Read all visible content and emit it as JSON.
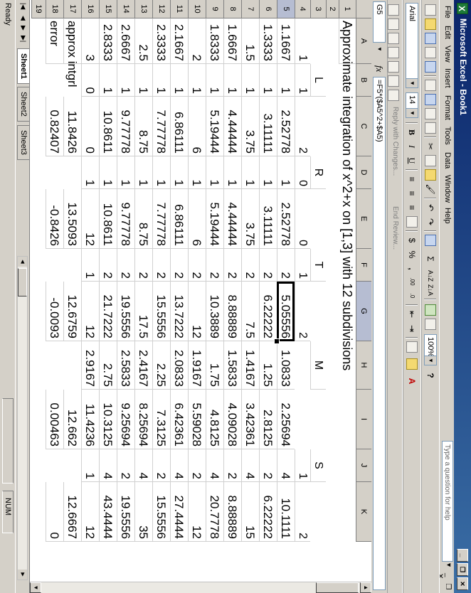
{
  "window": {
    "title": "Microsoft Excel - Book1",
    "app_icon_label": "X"
  },
  "menu": {
    "items": [
      "File",
      "Edit",
      "View",
      "Insert",
      "Format",
      "Tools",
      "Data",
      "Window",
      "Help"
    ],
    "help_placeholder": "Type a question for help"
  },
  "toolbar": {
    "font_name": "Arial",
    "font_size": "14",
    "zoom": "100%",
    "bold_label": "B",
    "italic_label": "I",
    "underline_label": "U",
    "currency_label": "$",
    "percent_label": "%",
    "comma_label": ",",
    "sum_label": "Σ",
    "reply_label": "Reply with Changes...",
    "end_review_label": "End Review..."
  },
  "formula_bar": {
    "name_box": "G5",
    "fx_label": "fx",
    "formula": "=F5*($A5^2+$A5)"
  },
  "grid": {
    "columns": [
      "A",
      "B",
      "C",
      "D",
      "E",
      "F",
      "G",
      "H",
      "I",
      "J",
      "K"
    ],
    "selected_column": "G",
    "selected_row": 5,
    "rows": [
      1,
      2,
      3,
      4,
      5,
      6,
      7,
      8,
      9,
      10,
      11,
      12,
      13,
      14,
      15,
      16,
      17,
      18,
      19
    ],
    "title": "Approximate integration of  x^2+x  on [1,3] with 12 subdivisions",
    "row3": {
      "B": "L",
      "D": "R",
      "F": "T",
      "H": "M",
      "J": "S"
    },
    "row4": {
      "A": "1",
      "B": "1",
      "C": "2",
      "D": "0",
      "E": "0",
      "F": "1",
      "G": "2",
      "J": "1",
      "K": "2"
    },
    "data_rows": [
      [
        "1.1667",
        "1",
        "2.52778",
        "1",
        "2.52778",
        "2",
        "5.05556",
        "1.0833",
        "2.25694",
        "4",
        "10.1111"
      ],
      [
        "1.3333",
        "1",
        "3.11111",
        "1",
        "3.11111",
        "2",
        "6.22222",
        "1.25",
        "2.8125",
        "2",
        "6.22222"
      ],
      [
        "1.5",
        "1",
        "3.75",
        "1",
        "3.75",
        "2",
        "7.5",
        "1.4167",
        "3.42361",
        "4",
        "15"
      ],
      [
        "1.6667",
        "1",
        "4.44444",
        "1",
        "4.44444",
        "2",
        "8.88889",
        "1.5833",
        "4.09028",
        "2",
        "8.88889"
      ],
      [
        "1.8333",
        "1",
        "5.19444",
        "1",
        "5.19444",
        "2",
        "10.3889",
        "1.75",
        "4.8125",
        "4",
        "20.7778"
      ],
      [
        "2",
        "1",
        "6",
        "1",
        "6",
        "2",
        "12",
        "1.9167",
        "5.59028",
        "2",
        "12"
      ],
      [
        "2.1667",
        "1",
        "6.86111",
        "1",
        "6.86111",
        "2",
        "13.7222",
        "2.0833",
        "6.42361",
        "4",
        "27.4444"
      ],
      [
        "2.3333",
        "1",
        "7.77778",
        "1",
        "7.77778",
        "2",
        "15.5556",
        "2.25",
        "7.3125",
        "2",
        "15.5556"
      ],
      [
        "2.5",
        "1",
        "8.75",
        "1",
        "8.75",
        "2",
        "17.5",
        "2.4167",
        "8.25694",
        "4",
        "35"
      ],
      [
        "2.6667",
        "1",
        "9.77778",
        "1",
        "9.77778",
        "2",
        "19.5556",
        "2.5833",
        "9.25694",
        "2",
        "19.5556"
      ],
      [
        "2.8333",
        "1",
        "10.8611",
        "1",
        "10.8611",
        "2",
        "21.7222",
        "2.75",
        "10.3125",
        "4",
        "43.4444"
      ],
      [
        "3",
        "0",
        "0",
        "1",
        "12",
        "1",
        "12",
        "2.9167",
        "11.4236",
        "1",
        "12"
      ]
    ],
    "row17": {
      "A": "approx intgrl",
      "C": "11.8426",
      "E": "13.5093",
      "G": "12.6759",
      "I": "12.662",
      "K": "12.6667"
    },
    "row18": {
      "A": "error",
      "C": "0.82407",
      "E": "-0.8426",
      "G": "-0.0093",
      "I": "0.00463",
      "K": "0"
    }
  },
  "sheets": {
    "tabs": [
      "Sheet1",
      "Sheet2",
      "Sheet3"
    ],
    "active": "Sheet1"
  },
  "status": {
    "left": "Ready",
    "right": "NUM"
  }
}
